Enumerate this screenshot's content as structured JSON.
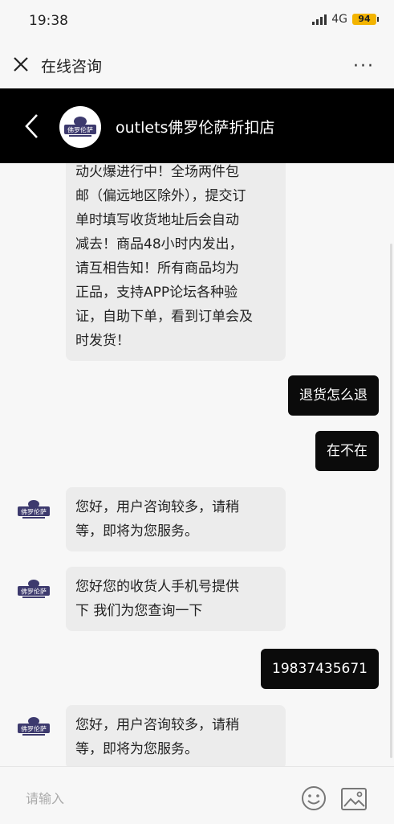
{
  "status": {
    "time": "19:38",
    "network": "4G",
    "battery": "94"
  },
  "nav": {
    "title": "在线咨询",
    "more": "···"
  },
  "shop": {
    "name": "outlets佛罗伦萨折扣店",
    "logo_text": "佛罗伦萨"
  },
  "messages": [
    {
      "from": "shop",
      "lines": [
        "动火爆进行中！全场两件包",
        "邮（偏远地区除外），提交订",
        "单时填写收货地址后会自动",
        "减去！商品48小时内发出，",
        "请互相告知！所有商品均为",
        "正品，支持APP论坛各种验",
        "证，自助下单，看到订单会及",
        "时发货！"
      ]
    },
    {
      "from": "user",
      "text": "退货怎么退"
    },
    {
      "from": "user",
      "text": "在不在"
    },
    {
      "from": "shop",
      "lines": [
        "您好，用户咨询较多，请稍",
        "等，即将为您服务。"
      ]
    },
    {
      "from": "shop",
      "lines": [
        "您好您的收货人手机号提供",
        "下 我们为您查询一下"
      ]
    },
    {
      "from": "user",
      "text": "19837435671"
    },
    {
      "from": "shop",
      "lines": [
        "您好，用户咨询较多，请稍",
        "等，即将为您服务。"
      ]
    }
  ],
  "input": {
    "placeholder": "请输入"
  },
  "icons": {
    "close": "close-icon",
    "more": "more-icon",
    "back": "back-arrow-icon",
    "emoji": "emoji-icon",
    "image": "image-icon"
  },
  "colors": {
    "header_bg": "#000000",
    "user_bubble": "#0b0b0b",
    "shop_bubble": "#ececec",
    "logo": "#3d3a6e"
  }
}
